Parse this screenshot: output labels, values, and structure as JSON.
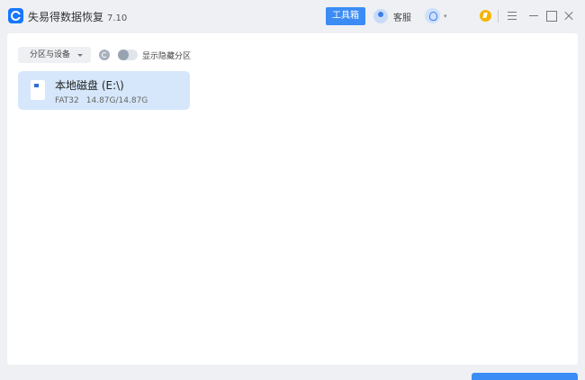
{
  "app": {
    "title": "失易得数据恢复",
    "version": "7.10",
    "logo_icon": "app-logo-icon"
  },
  "header": {
    "toolbox_label": "工具箱",
    "service_label": "客服",
    "user_caret": "▾"
  },
  "toolbar": {
    "partition_dropdown_label": "分区与设备",
    "show_hidden_label": "显示隐藏分区",
    "show_hidden_on": false
  },
  "disks": [
    {
      "name": "本地磁盘 (E:\\)",
      "filesystem": "FAT32",
      "capacity": "14.87G/14.87G"
    }
  ],
  "colors": {
    "accent": "#3b8cf5",
    "selected_card": "#d6e7fb",
    "vip": "#f5b400"
  }
}
